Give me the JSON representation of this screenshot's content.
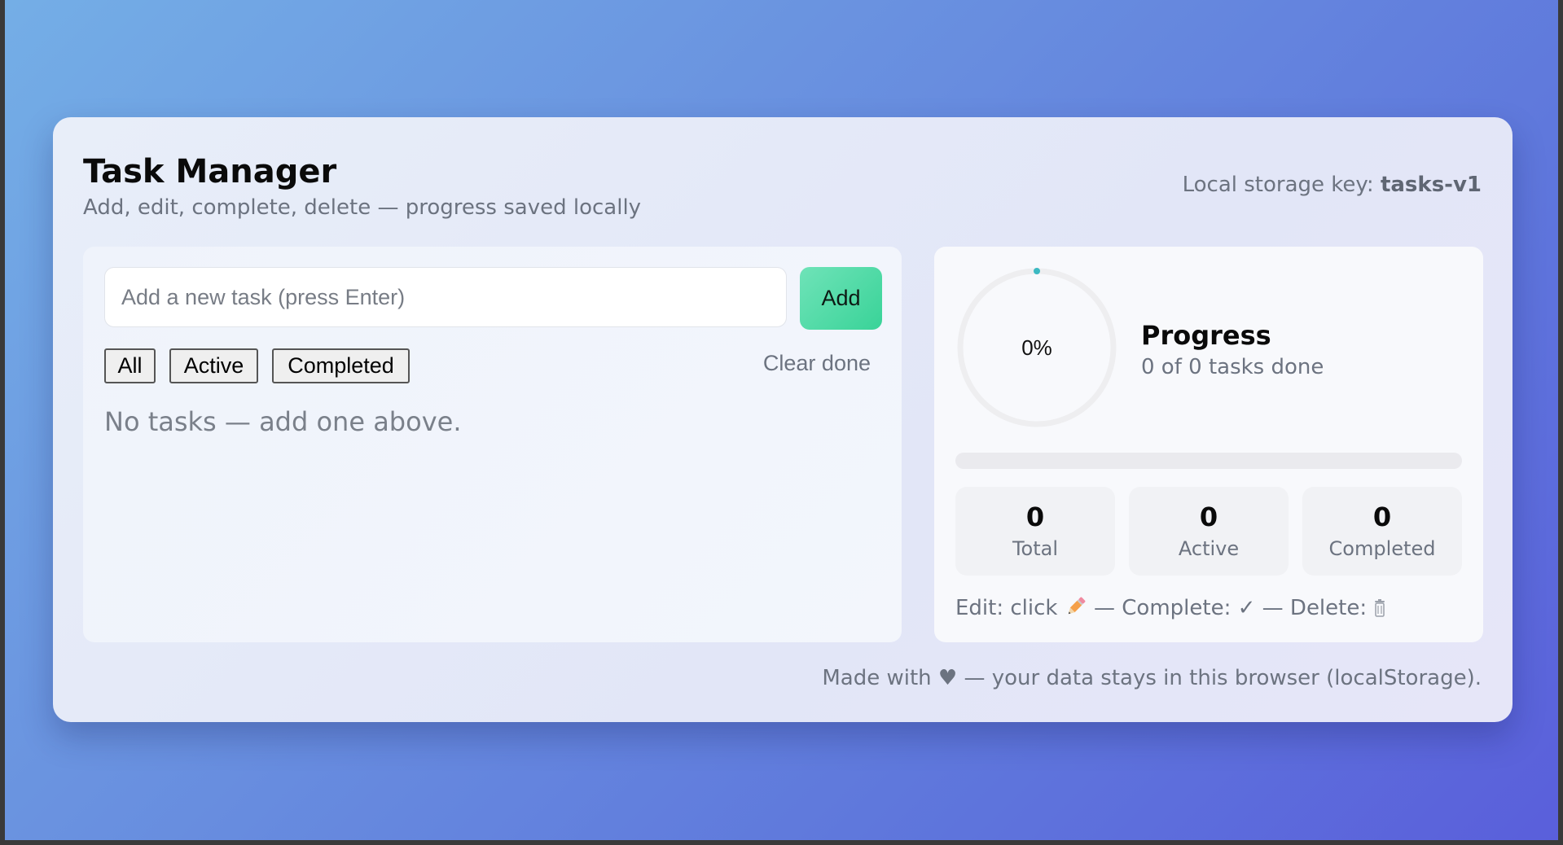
{
  "header": {
    "title": "Task Manager",
    "subtitle": "Add, edit, complete, delete — progress saved locally",
    "storage_label": "Local storage key: ",
    "storage_key": "tasks-v1"
  },
  "composer": {
    "placeholder": "Add a new task (press Enter)",
    "value": "",
    "add_label": "Add"
  },
  "filters": {
    "all": "All",
    "active": "Active",
    "completed": "Completed",
    "clear_done": "Clear done"
  },
  "tasks": {
    "empty_message": "No tasks — add one above."
  },
  "progress": {
    "percent_text": "0%",
    "fraction": 0,
    "title": "Progress",
    "summary": "0 of 0 tasks done",
    "accent": "#3cb9c2"
  },
  "stats": {
    "total_value": "0",
    "total_label": "Total",
    "active_value": "0",
    "active_label": "Active",
    "completed_value": "0",
    "completed_label": "Completed"
  },
  "help": {
    "edit": "Edit: click",
    "complete": " — Complete: ",
    "check": "✓",
    "delete": " — Delete: "
  },
  "footer": {
    "text_before": "Made with ",
    "heart": "♥",
    "text_after": " — your data stays in this browser (localStorage)."
  }
}
